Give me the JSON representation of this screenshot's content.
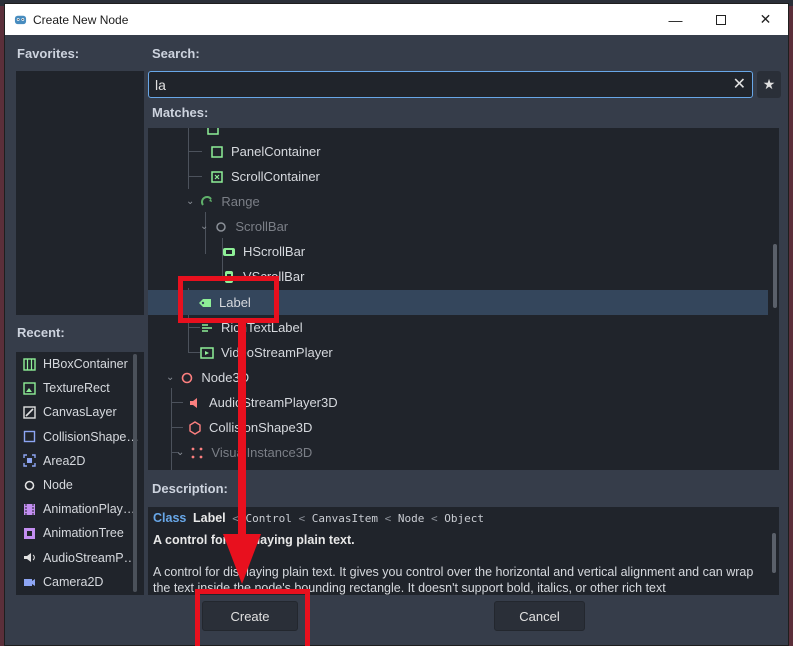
{
  "window": {
    "title": "Create New Node"
  },
  "labels": {
    "favorites": "Favorites:",
    "search": "Search:",
    "matches": "Matches:",
    "recent": "Recent:",
    "description": "Description:"
  },
  "search": {
    "value": "la",
    "placeholder": ""
  },
  "tree": {
    "items": [
      {
        "label": "PanelContainer",
        "icon": "panel-container-icon"
      },
      {
        "label": "ScrollContainer",
        "icon": "scroll-container-icon"
      },
      {
        "label": "Range",
        "icon": "range-icon",
        "dim": true
      },
      {
        "label": "ScrollBar",
        "icon": "scrollbar-icon",
        "dim": true
      },
      {
        "label": "HScrollBar",
        "icon": "hscrollbar-icon"
      },
      {
        "label": "VScrollBar",
        "icon": "vscrollbar-icon"
      },
      {
        "label": "Label",
        "icon": "label-icon",
        "selected": true
      },
      {
        "label": "RichTextLabel",
        "icon": "rich-text-label-icon"
      },
      {
        "label": "VideoStreamPlayer",
        "icon": "video-stream-player-icon"
      },
      {
        "label": "Node3D",
        "icon": "node3d-icon"
      },
      {
        "label": "AudioStreamPlayer3D",
        "icon": "audio-stream-player-3d-icon"
      },
      {
        "label": "CollisionShape3D",
        "icon": "collision-shape-3d-icon"
      },
      {
        "label": "VisualInstance3D",
        "icon": "visual-instance-3d-icon",
        "dim": true
      }
    ]
  },
  "recent": {
    "items": [
      {
        "label": "HBoxContainer"
      },
      {
        "label": "TextureRect"
      },
      {
        "label": "CanvasLayer"
      },
      {
        "label": "CollisionShape…"
      },
      {
        "label": "Area2D"
      },
      {
        "label": "Node"
      },
      {
        "label": "AnimationPlay…"
      },
      {
        "label": "AnimationTree"
      },
      {
        "label": "AudioStreamP…"
      },
      {
        "label": "Camera2D"
      }
    ]
  },
  "description": {
    "class_keyword": "Class",
    "class_name": "Label",
    "inherits": [
      "Control",
      "CanvasItem",
      "Node",
      "Object"
    ],
    "separator": "<",
    "brief": "A control for displaying plain text.",
    "text": "A control for displaying plain text. It gives you control over the horizontal and vertical alignment and can wrap the text inside the node's bounding rectangle. It doesn't support bold, italics, or other rich text"
  },
  "buttons": {
    "create": "Create",
    "cancel": "Cancel"
  },
  "colors": {
    "accent": "#68a7e8",
    "annotation_red": "#e8101e",
    "control_green": "#8eef97",
    "node3d_red": "#fc7f7f"
  }
}
